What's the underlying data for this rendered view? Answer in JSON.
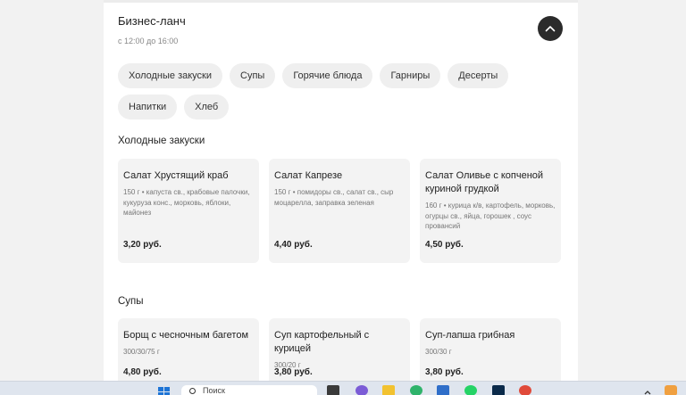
{
  "header": {
    "title": "Бизнес-ланч",
    "subtitle": "с 12:00 до 16:00"
  },
  "categories": [
    "Холодные закуски",
    "Супы",
    "Горячие блюда",
    "Гарниры",
    "Десерты",
    "Напитки",
    "Хлеб"
  ],
  "sections": [
    {
      "title": "Холодные закуски",
      "items": [
        {
          "name": "Салат Хрустящий краб",
          "desc": "150 г • капуста св., крабовые палочки, кукуруза конс., морковь, яблоки, майонез",
          "price": "3,20 руб."
        },
        {
          "name": "Салат Капрезе",
          "desc": "150 г • помидоры св., салат св., сыр моцарелла, заправка зеленая",
          "price": "4,40 руб."
        },
        {
          "name": "Салат Оливье с копченой куриной грудкой",
          "desc": "160 г • курица к/в, картофель, морковь, огурцы св., яйца, горошек , соус провансий",
          "price": "4,50 руб."
        }
      ]
    },
    {
      "title": "Супы",
      "items": [
        {
          "name": "Борщ с чесночным багетом",
          "desc": "300/30/75 г",
          "price": "4,80 руб."
        },
        {
          "name": "Суп картофельный с курицей",
          "desc": "300/20 г",
          "price": "3,80 руб."
        },
        {
          "name": "Суп-лапша грибная",
          "desc": "300/30 г",
          "price": "3,80 руб."
        }
      ]
    }
  ],
  "taskbar": {
    "search_placeholder": "Поиск",
    "icons": [
      "windows-start-icon",
      "task-view-icon",
      "chat-icon",
      "file-explorer-icon",
      "chrome-canary-icon",
      "store-icon",
      "whatsapp-icon",
      "photoshop-icon",
      "premiere-icon",
      "chrome-icon",
      "tray-chevron-icon"
    ]
  },
  "colors": {
    "page_bg": "#f2f2f2",
    "panel_bg": "#ffffff",
    "chip_bg": "#efefef",
    "card_bg": "#f3f3f3",
    "button_dark": "#2b2b2b",
    "taskbar_bg": "#dfe5ee"
  }
}
